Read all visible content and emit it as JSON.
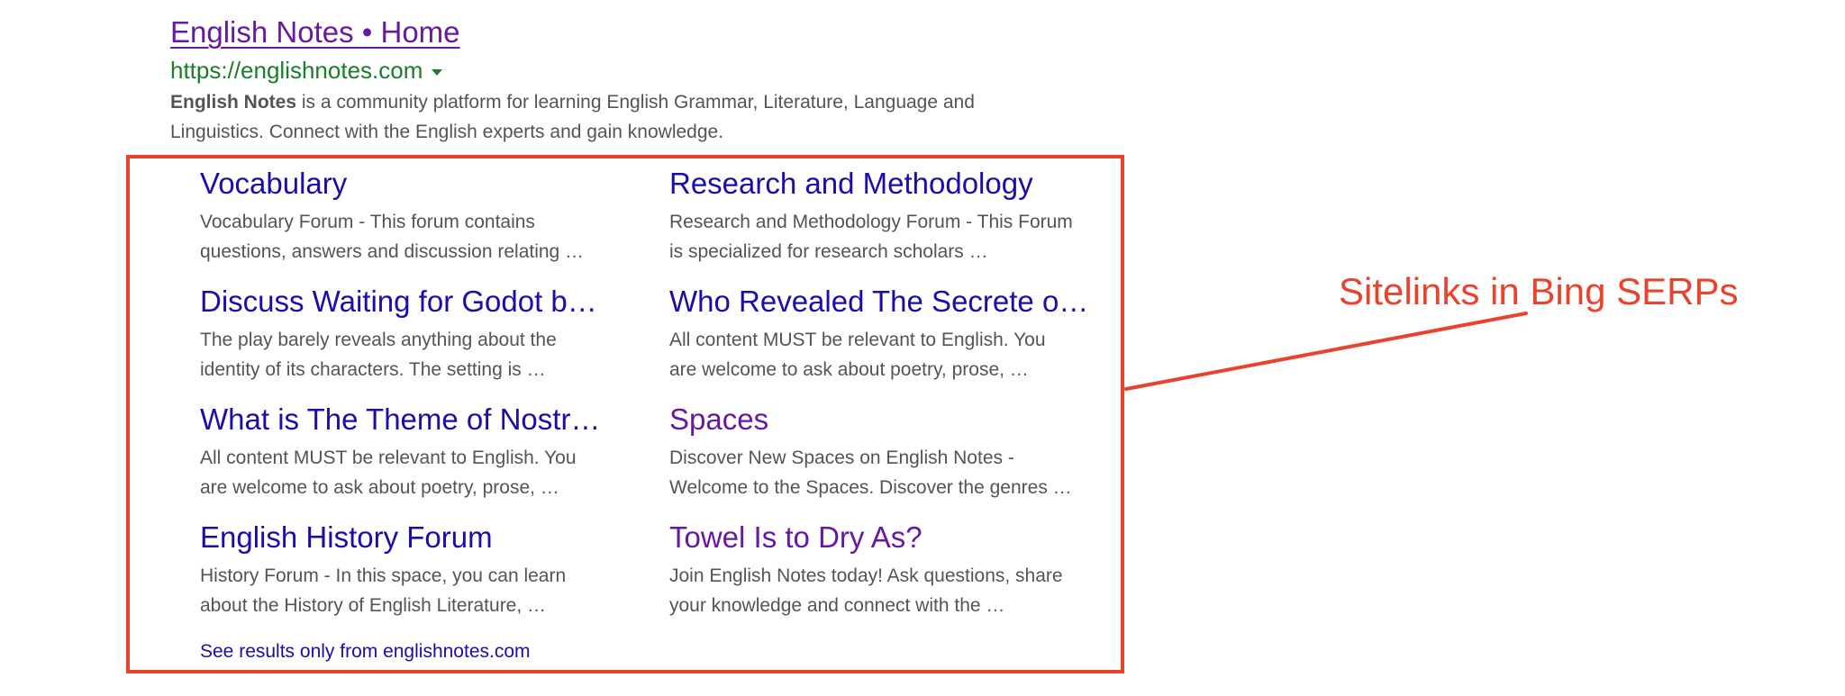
{
  "result": {
    "title": "English Notes • Home",
    "url": "https://englishnotes.com",
    "snippet_bold": "English Notes",
    "snippet_line1": " is a community platform for learning English Grammar, Literature, Language and",
    "snippet_line2": "Linguistics. Connect with the English experts and gain knowledge."
  },
  "sitelinks": [
    {
      "title": "Vocabulary",
      "desc1": "Vocabulary Forum - This forum contains",
      "desc2": "questions, answers and discussion relating …"
    },
    {
      "title": "Research and Methodology",
      "desc1": "Research and Methodology Forum - This Forum",
      "desc2": "is specialized for research scholars …"
    },
    {
      "title": "Discuss Waiting for Godot b…",
      "desc1": "The play barely reveals anything about the",
      "desc2": "identity of its characters. The setting is …"
    },
    {
      "title": "Who Revealed The Secrete o…",
      "desc1": "All content MUST be relevant to English. You",
      "desc2": "are welcome to ask about poetry, prose, …"
    },
    {
      "title": "What is The Theme of Nostr…",
      "desc1": "All content MUST be relevant to English. You",
      "desc2": "are welcome to ask about poetry, prose, …"
    },
    {
      "title": "Spaces",
      "desc1": "Discover New Spaces on English Notes -",
      "desc2": "Welcome to the Spaces. Discover the genres …"
    },
    {
      "title": "English History Forum",
      "desc1": "History Forum - In this space, you can learn",
      "desc2": "about the History of English Literature, …"
    },
    {
      "title": "Towel Is to Dry As?",
      "desc1": "Join English Notes today! Ask questions, share",
      "desc2": "your knowledge and connect with the …"
    }
  ],
  "see_results": "See results only from englishnotes.com",
  "annotation": {
    "label": "Sitelinks in Bing SERPs"
  },
  "colors": {
    "link": "#1a0dab",
    "visited": "#661aa0",
    "url": "#1a7d2a",
    "snippet": "#545454",
    "annotation": "#e8432c"
  },
  "icons": {
    "url_caret": "caret-down-icon"
  }
}
